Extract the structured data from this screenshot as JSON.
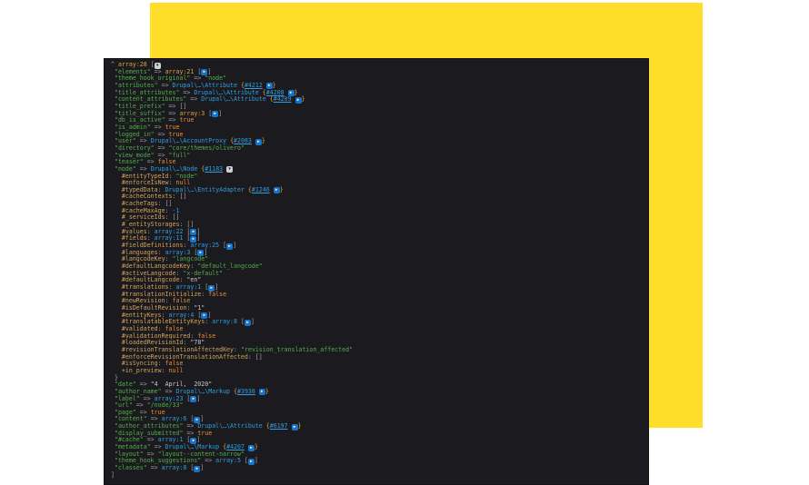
{
  "colors": {
    "background": "#ffffff",
    "yellow_accent": "#ffde2a",
    "panel_background": "#1b1b1f",
    "key_green": "#4fae4a",
    "array_amber": "#dfa33c",
    "class_blue": "#2f9fe0",
    "const_orange": "#ef8c33",
    "property_tan": "#d4a358",
    "pale_string": "#c9c9ce",
    "punctuation_gray": "#9fa0a6"
  },
  "dump": {
    "lines": [
      [
        [
          "o",
          "^"
        ],
        [
          "p",
          " "
        ],
        [
          "a",
          "array:28"
        ],
        [
          "p",
          " ["
        ],
        [
          "F",
          "▼"
        ]
      ],
      [
        [
          "p",
          " "
        ],
        [
          "g",
          "\"elements\""
        ],
        [
          "p",
          " => "
        ],
        [
          "a",
          "array:21"
        ],
        [
          "p",
          " ["
        ],
        [
          "B",
          "▶"
        ],
        [
          "p",
          "]"
        ]
      ],
      [
        [
          "p",
          " "
        ],
        [
          "g",
          "\"theme_hook_original\""
        ],
        [
          "p",
          " => "
        ],
        [
          "g",
          "\"node\""
        ]
      ],
      [
        [
          "p",
          " "
        ],
        [
          "g",
          "\"attributes\""
        ],
        [
          "p",
          " => "
        ],
        [
          "b",
          "Drupal\\…\\Attribute"
        ],
        [
          "p",
          " "
        ],
        [
          "a",
          "{"
        ],
        [
          "r",
          "#4212"
        ],
        [
          "p",
          " "
        ],
        [
          "B",
          "▶"
        ],
        [
          "a",
          "}"
        ]
      ],
      [
        [
          "p",
          " "
        ],
        [
          "g",
          "\"title_attributes\""
        ],
        [
          "p",
          " => "
        ],
        [
          "b",
          "Drupal\\…\\Attribute"
        ],
        [
          "p",
          " "
        ],
        [
          "a",
          "{"
        ],
        [
          "r",
          "#4208"
        ],
        [
          "p",
          " "
        ],
        [
          "B",
          "▶"
        ],
        [
          "a",
          "}"
        ]
      ],
      [
        [
          "p",
          " "
        ],
        [
          "g",
          "\"content_attributes\""
        ],
        [
          "p",
          " => "
        ],
        [
          "b",
          "Drupal\\…\\Attribute"
        ],
        [
          "p",
          " "
        ],
        [
          "a",
          "{"
        ],
        [
          "r",
          "#4209"
        ],
        [
          "p",
          " "
        ],
        [
          "B",
          "▶"
        ],
        [
          "a",
          "}"
        ]
      ],
      [
        [
          "p",
          " "
        ],
        [
          "g",
          "\"title_prefix\""
        ],
        [
          "p",
          " => []"
        ]
      ],
      [
        [
          "p",
          " "
        ],
        [
          "g",
          "\"title_suffix\""
        ],
        [
          "p",
          " => "
        ],
        [
          "a",
          "array:3"
        ],
        [
          "p",
          " ["
        ],
        [
          "B",
          "▶"
        ],
        [
          "p",
          "]"
        ]
      ],
      [
        [
          "p",
          " "
        ],
        [
          "g",
          "\"db_is_active\""
        ],
        [
          "p",
          " => "
        ],
        [
          "o",
          "true"
        ]
      ],
      [
        [
          "p",
          " "
        ],
        [
          "g",
          "\"is_admin\""
        ],
        [
          "p",
          " => "
        ],
        [
          "o",
          "true"
        ]
      ],
      [
        [
          "p",
          " "
        ],
        [
          "g",
          "\"logged_in\""
        ],
        [
          "p",
          " => "
        ],
        [
          "o",
          "true"
        ]
      ],
      [
        [
          "p",
          " "
        ],
        [
          "g",
          "\"user\""
        ],
        [
          "p",
          " => "
        ],
        [
          "b",
          "Drupal\\…\\AccountProxy"
        ],
        [
          "p",
          " "
        ],
        [
          "a",
          "{"
        ],
        [
          "r",
          "#2083"
        ],
        [
          "p",
          " "
        ],
        [
          "B",
          "▶"
        ],
        [
          "a",
          "}"
        ]
      ],
      [
        [
          "p",
          " "
        ],
        [
          "g",
          "\"directory\""
        ],
        [
          "p",
          " => "
        ],
        [
          "g",
          "\"core/themes/olivero\""
        ]
      ],
      [
        [
          "p",
          " "
        ],
        [
          "g",
          "\"view_mode\""
        ],
        [
          "p",
          " => "
        ],
        [
          "g",
          "\"full\""
        ]
      ],
      [
        [
          "p",
          " "
        ],
        [
          "g",
          "\"teaser\""
        ],
        [
          "p",
          " => "
        ],
        [
          "o",
          "false"
        ]
      ],
      [
        [
          "p",
          " "
        ],
        [
          "g",
          "\"node\""
        ],
        [
          "p",
          " => "
        ],
        [
          "b",
          "Drupal\\…\\Node"
        ],
        [
          "p",
          " "
        ],
        [
          "a",
          "{"
        ],
        [
          "r",
          "#1183"
        ],
        [
          "p",
          " "
        ],
        [
          "L",
          "▼"
        ]
      ],
      [
        [
          "p",
          "   "
        ],
        [
          "t",
          "#entityTypeId"
        ],
        [
          "p",
          ": "
        ],
        [
          "g",
          "\"node\""
        ]
      ],
      [
        [
          "p",
          "   "
        ],
        [
          "t",
          "#enforceIsNew"
        ],
        [
          "p",
          ": "
        ],
        [
          "o",
          "null"
        ]
      ],
      [
        [
          "p",
          "   "
        ],
        [
          "t",
          "#typedData"
        ],
        [
          "p",
          ": "
        ],
        [
          "b",
          "Drupal\\…\\EntityAdapter"
        ],
        [
          "p",
          " "
        ],
        [
          "a",
          "{"
        ],
        [
          "r",
          "#1246"
        ],
        [
          "p",
          " "
        ],
        [
          "B",
          "▶"
        ],
        [
          "a",
          "}"
        ]
      ],
      [
        [
          "p",
          "   "
        ],
        [
          "t",
          "#cacheContexts"
        ],
        [
          "p",
          ": []"
        ]
      ],
      [
        [
          "p",
          "   "
        ],
        [
          "t",
          "#cacheTags"
        ],
        [
          "p",
          ": []"
        ]
      ],
      [
        [
          "p",
          "   "
        ],
        [
          "t",
          "#cacheMaxAge"
        ],
        [
          "p",
          ": "
        ],
        [
          "b",
          "-1"
        ]
      ],
      [
        [
          "p",
          "   "
        ],
        [
          "t",
          "#_serviceIds"
        ],
        [
          "p",
          ": []"
        ]
      ],
      [
        [
          "p",
          "   "
        ],
        [
          "t",
          "#_entityStorages"
        ],
        [
          "p",
          ": []"
        ]
      ],
      [
        [
          "p",
          "   "
        ],
        [
          "t",
          "#values"
        ],
        [
          "p",
          ": "
        ],
        [
          "b",
          "array:22"
        ],
        [
          "p",
          " ["
        ],
        [
          "B",
          "▶"
        ],
        [
          "p",
          "]"
        ]
      ],
      [
        [
          "p",
          "   "
        ],
        [
          "t",
          "#fields"
        ],
        [
          "p",
          ": "
        ],
        [
          "b",
          "array:11"
        ],
        [
          "p",
          " ["
        ],
        [
          "B",
          "▶"
        ],
        [
          "p",
          "]"
        ]
      ],
      [
        [
          "p",
          "   "
        ],
        [
          "t",
          "#fieldDefinitions"
        ],
        [
          "p",
          ": "
        ],
        [
          "b",
          "array:25"
        ],
        [
          "p",
          " ["
        ],
        [
          "B",
          "▶"
        ],
        [
          "p",
          "]"
        ]
      ],
      [
        [
          "p",
          "   "
        ],
        [
          "t",
          "#languages"
        ],
        [
          "p",
          ": "
        ],
        [
          "b",
          "array:3"
        ],
        [
          "p",
          " ["
        ],
        [
          "B",
          "▶"
        ],
        [
          "p",
          "]"
        ]
      ],
      [
        [
          "p",
          "   "
        ],
        [
          "t",
          "#langcodeKey"
        ],
        [
          "p",
          ": "
        ],
        [
          "g",
          "\"langcode\""
        ]
      ],
      [
        [
          "p",
          "   "
        ],
        [
          "t",
          "#defaultLangcodeKey"
        ],
        [
          "p",
          ": "
        ],
        [
          "g",
          "\"default_langcode\""
        ]
      ],
      [
        [
          "p",
          "   "
        ],
        [
          "t",
          "#activeLangcode"
        ],
        [
          "p",
          ": "
        ],
        [
          "g",
          "\"x-default\""
        ]
      ],
      [
        [
          "p",
          "   "
        ],
        [
          "t",
          "#defaultLangcode"
        ],
        [
          "p",
          ": "
        ],
        [
          "w",
          "\"en\""
        ]
      ],
      [
        [
          "p",
          "   "
        ],
        [
          "t",
          "#translations"
        ],
        [
          "p",
          ": "
        ],
        [
          "b",
          "array:1"
        ],
        [
          "p",
          " ["
        ],
        [
          "B",
          "▶"
        ],
        [
          "p",
          "]"
        ]
      ],
      [
        [
          "p",
          "   "
        ],
        [
          "t",
          "#translationInitialize"
        ],
        [
          "p",
          ": "
        ],
        [
          "o",
          "false"
        ]
      ],
      [
        [
          "p",
          "   "
        ],
        [
          "t",
          "#newRevision"
        ],
        [
          "p",
          ": "
        ],
        [
          "o",
          "false"
        ]
      ],
      [
        [
          "p",
          "   "
        ],
        [
          "t",
          "#isDefaultRevision"
        ],
        [
          "p",
          ": "
        ],
        [
          "w",
          "\"1\""
        ]
      ],
      [
        [
          "p",
          "   "
        ],
        [
          "t",
          "#entityKeys"
        ],
        [
          "p",
          ": "
        ],
        [
          "b",
          "array:4"
        ],
        [
          "p",
          " ["
        ],
        [
          "B",
          "▶"
        ],
        [
          "p",
          "]"
        ]
      ],
      [
        [
          "p",
          "   "
        ],
        [
          "t",
          "#translatableEntityKeys"
        ],
        [
          "p",
          ": "
        ],
        [
          "b",
          "array:8"
        ],
        [
          "p",
          " ["
        ],
        [
          "B",
          "▶"
        ],
        [
          "p",
          "]"
        ]
      ],
      [
        [
          "p",
          "   "
        ],
        [
          "t",
          "#validated"
        ],
        [
          "p",
          ": "
        ],
        [
          "o",
          "false"
        ]
      ],
      [
        [
          "p",
          "   "
        ],
        [
          "t",
          "#validationRequired"
        ],
        [
          "p",
          ": "
        ],
        [
          "o",
          "false"
        ]
      ],
      [
        [
          "p",
          "   "
        ],
        [
          "t",
          "#loadedRevisionId"
        ],
        [
          "p",
          ": "
        ],
        [
          "w",
          "\"78\""
        ]
      ],
      [
        [
          "p",
          "   "
        ],
        [
          "t",
          "#revisionTranslationAffectedKey"
        ],
        [
          "p",
          ": "
        ],
        [
          "g",
          "\"revision_translation_affected\""
        ]
      ],
      [
        [
          "p",
          "   "
        ],
        [
          "t",
          "#enforceRevisionTranslationAffected"
        ],
        [
          "p",
          ": []"
        ]
      ],
      [
        [
          "p",
          "   "
        ],
        [
          "t",
          "#isSyncing"
        ],
        [
          "p",
          ": "
        ],
        [
          "o",
          "false"
        ]
      ],
      [
        [
          "p",
          "   "
        ],
        [
          "t",
          "+in_preview"
        ],
        [
          "p",
          ": "
        ],
        [
          "o",
          "null"
        ]
      ],
      [
        [
          "p",
          " }"
        ]
      ],
      [
        [
          "p",
          " "
        ],
        [
          "g",
          "\"date\""
        ],
        [
          "p",
          " => "
        ],
        [
          "w",
          "\"4  April,  2020\""
        ]
      ],
      [
        [
          "p",
          " "
        ],
        [
          "g",
          "\"author_name\""
        ],
        [
          "p",
          " => "
        ],
        [
          "b",
          "Drupal\\…\\Markup"
        ],
        [
          "p",
          " "
        ],
        [
          "a",
          "{"
        ],
        [
          "r",
          "#3938"
        ],
        [
          "p",
          " "
        ],
        [
          "B",
          "▶"
        ],
        [
          "a",
          "}"
        ]
      ],
      [
        [
          "p",
          " "
        ],
        [
          "g",
          "\"label\""
        ],
        [
          "p",
          " => "
        ],
        [
          "b",
          "array:23"
        ],
        [
          "p",
          " ["
        ],
        [
          "B",
          "▶"
        ],
        [
          "p",
          "]"
        ]
      ],
      [
        [
          "p",
          " "
        ],
        [
          "g",
          "\"url\""
        ],
        [
          "p",
          " => "
        ],
        [
          "g",
          "\"/node/33\""
        ]
      ],
      [
        [
          "p",
          " "
        ],
        [
          "g",
          "\"page\""
        ],
        [
          "p",
          " => "
        ],
        [
          "o",
          "true"
        ]
      ],
      [
        [
          "p",
          " "
        ],
        [
          "g",
          "\"content\""
        ],
        [
          "p",
          " => "
        ],
        [
          "b",
          "array:6"
        ],
        [
          "p",
          " ["
        ],
        [
          "B",
          "▶"
        ],
        [
          "p",
          "]"
        ]
      ],
      [
        [
          "p",
          " "
        ],
        [
          "g",
          "\"author_attributes\""
        ],
        [
          "p",
          " => "
        ],
        [
          "b",
          "Drupal\\…\\Attribute"
        ],
        [
          "p",
          " "
        ],
        [
          "a",
          "{"
        ],
        [
          "r",
          "#6197"
        ],
        [
          "p",
          " "
        ],
        [
          "B",
          "▶"
        ],
        [
          "a",
          "}"
        ]
      ],
      [
        [
          "p",
          " "
        ],
        [
          "g",
          "\"display_submitted\""
        ],
        [
          "p",
          " => "
        ],
        [
          "o",
          "true"
        ]
      ],
      [
        [
          "p",
          " "
        ],
        [
          "g",
          "\"#cache\""
        ],
        [
          "p",
          " => "
        ],
        [
          "b",
          "array:1"
        ],
        [
          "p",
          " ["
        ],
        [
          "B",
          "▶"
        ],
        [
          "p",
          "]"
        ]
      ],
      [
        [
          "p",
          " "
        ],
        [
          "g",
          "\"metadata\""
        ],
        [
          "p",
          " => "
        ],
        [
          "b",
          "Drupal\\…\\Markup"
        ],
        [
          "p",
          " "
        ],
        [
          "a",
          "{"
        ],
        [
          "r",
          "#4207"
        ],
        [
          "p",
          " "
        ],
        [
          "B",
          "▶"
        ],
        [
          "a",
          "}"
        ]
      ],
      [
        [
          "p",
          " "
        ],
        [
          "g",
          "\"layout\""
        ],
        [
          "p",
          " => "
        ],
        [
          "g",
          "\"layout--content-narrow\""
        ]
      ],
      [
        [
          "p",
          " "
        ],
        [
          "g",
          "\"theme_hook_suggestions\""
        ],
        [
          "p",
          " => "
        ],
        [
          "b",
          "array:5"
        ],
        [
          "p",
          " ["
        ],
        [
          "B",
          "▶"
        ],
        [
          "p",
          "]"
        ]
      ],
      [
        [
          "p",
          " "
        ],
        [
          "g",
          "\"classes\""
        ],
        [
          "p",
          " => "
        ],
        [
          "b",
          "array:8"
        ],
        [
          "p",
          " ["
        ],
        [
          "B",
          "▶"
        ],
        [
          "p",
          "]"
        ]
      ],
      [
        [
          "p",
          "]"
        ]
      ]
    ]
  }
}
